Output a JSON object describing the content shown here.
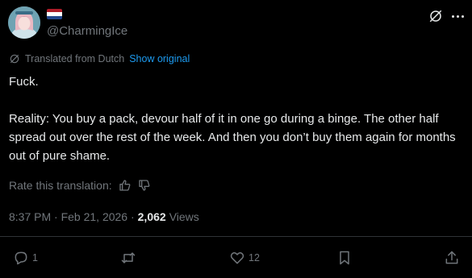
{
  "author": {
    "handle": "@CharmingIce",
    "flag_colors": [
      "#ae1c28",
      "#ffffff",
      "#21468b"
    ]
  },
  "translation": {
    "label": "Translated from Dutch",
    "show_original": "Show original"
  },
  "tweet": {
    "line1": "Fuck.",
    "paragraph2": "Reality: You buy a pack, devour half of it in one go during a binge. The other half spread out over the rest of the week. And then you don’t buy them again for months out of pure shame."
  },
  "rate": {
    "label": "Rate this translation:"
  },
  "meta": {
    "timestamp": "8:37 PM · Feb 21, 2026 ·",
    "views_count": "2,062",
    "views_label": "Views"
  },
  "actions": {
    "reply_count": "1",
    "like_count": "12"
  },
  "colors": {
    "background": "#000000",
    "text": "#e7e9ea",
    "muted": "#71767b",
    "link": "#1d9bf0",
    "divider": "#2f3336"
  },
  "icons": [
    "grok-icon",
    "more-icon",
    "translate-icon",
    "thumbs-up-icon",
    "thumbs-down-icon",
    "reply-icon",
    "repost-icon",
    "like-icon",
    "bookmark-icon",
    "share-icon"
  ]
}
